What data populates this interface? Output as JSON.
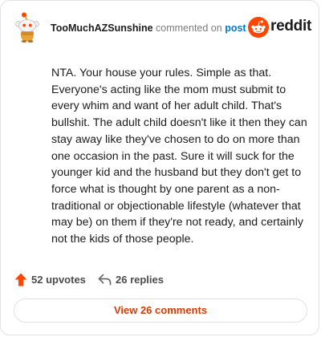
{
  "header": {
    "username": "TooMuchAZSunshine",
    "action_text": "commented on",
    "target_link": "post",
    "brand": "reddit",
    "avatar_icon": "snoo-avatar-icon",
    "brand_icon": "reddit-logo-icon"
  },
  "comment": {
    "body": "NTA. Your house your rules. Simple as that. Everyone's acting like the mom must submit to every whim and want of her adult child. That's bullshit. The adult child doesn't like it then they can stay away like they've chosen to do on more than one occasion in the past. Sure it will suck for the younger kid and the husband but they don't get to force what is thought by one parent as a non-traditional or objectionable lifestyle (whatever that may be) on them if they're not ready, and certainly not the kids of those people."
  },
  "actions": {
    "upvotes_label": "52 upvotes",
    "upvote_icon": "upvote-arrow-icon",
    "replies_label": "26 replies",
    "reply_icon": "reply-arrow-icon"
  },
  "footer": {
    "view_comments_label": "View 26 comments"
  },
  "colors": {
    "brand_orange": "#ff4500",
    "link_blue": "#0079d3",
    "view_button_text": "#d93a00"
  }
}
